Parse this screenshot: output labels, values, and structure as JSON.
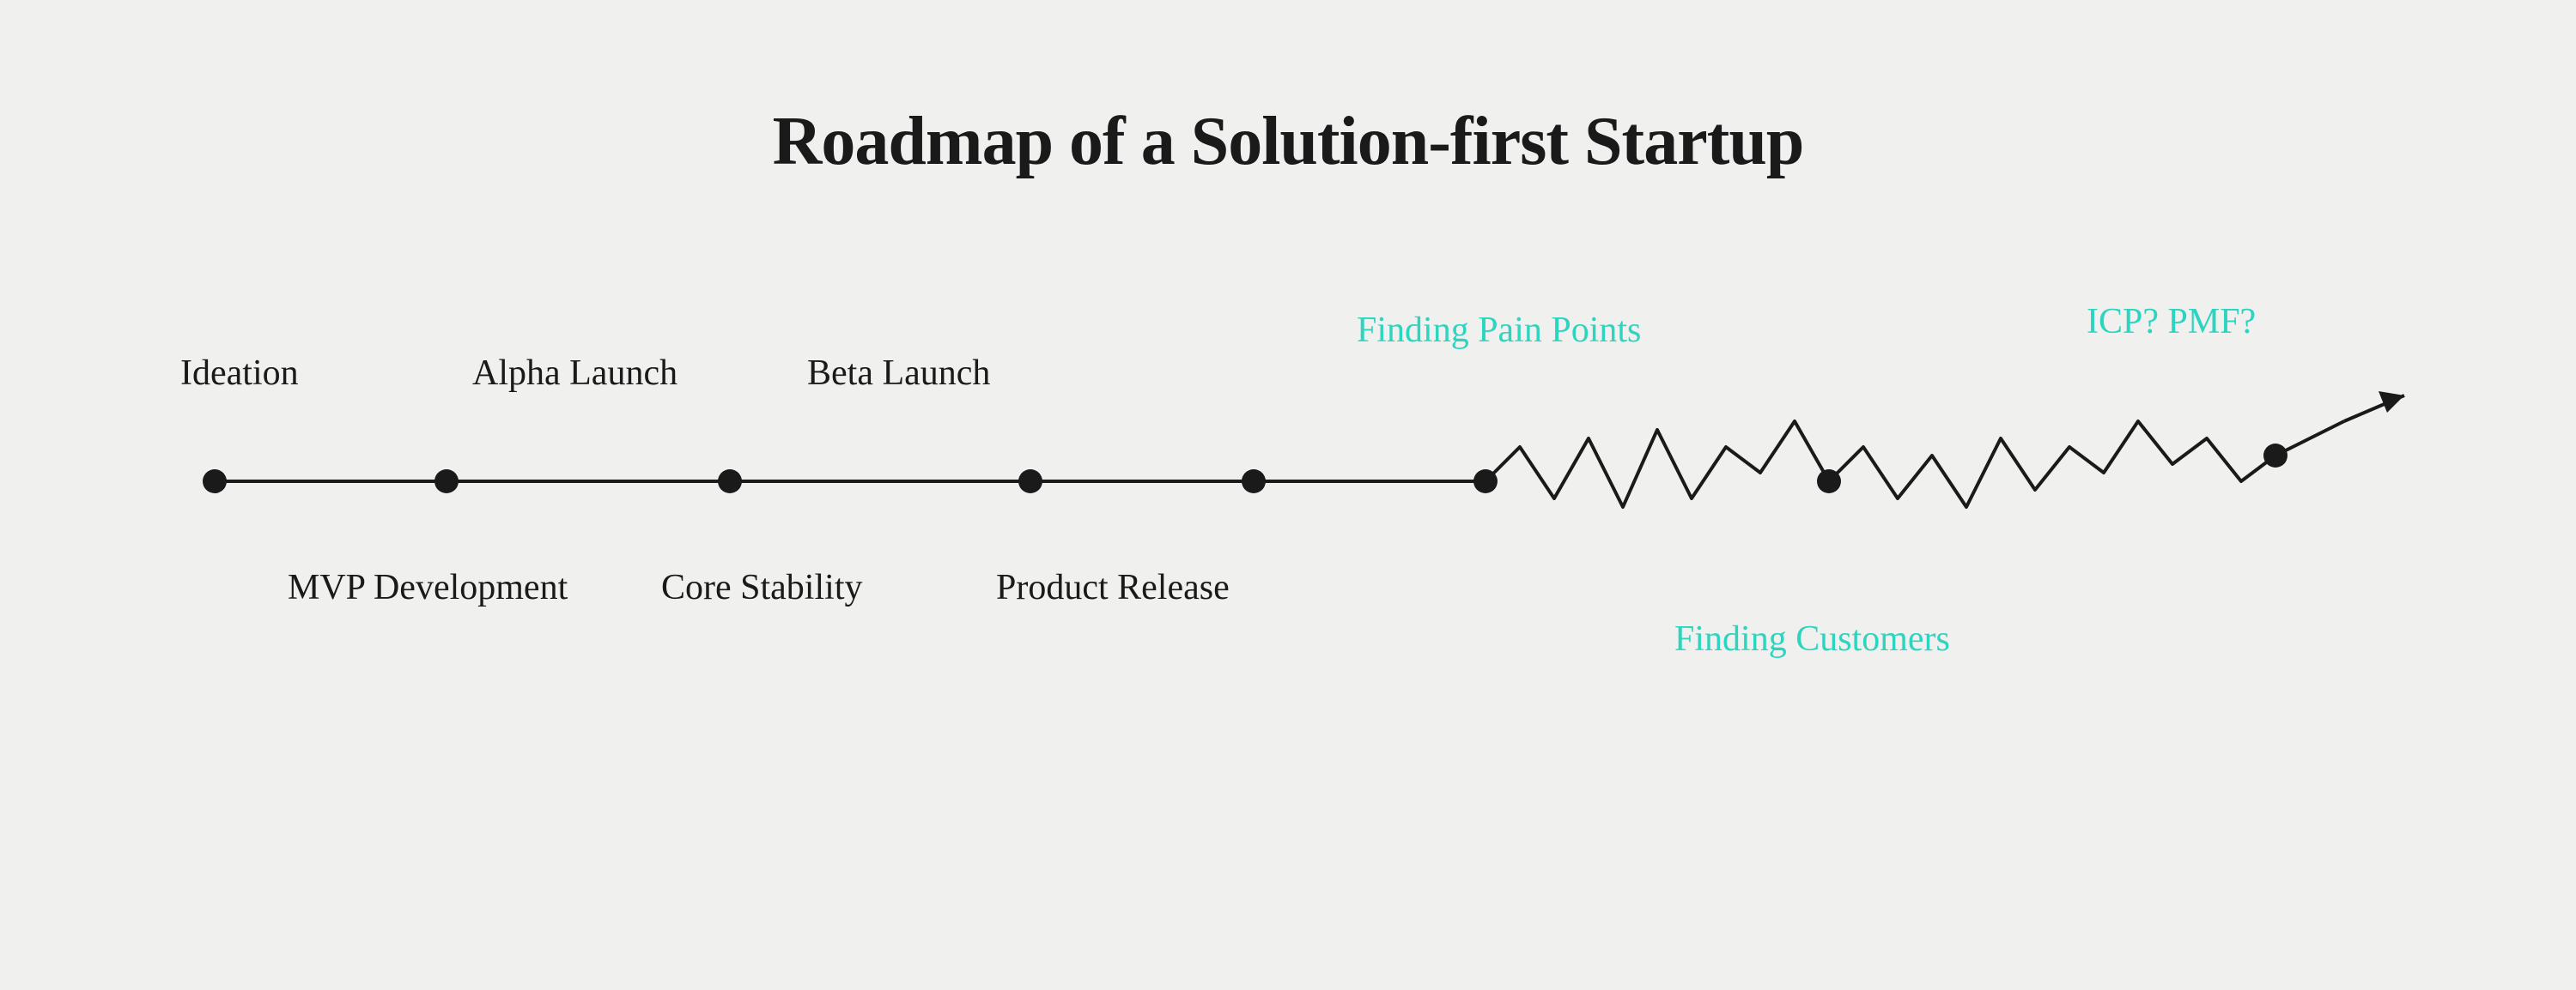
{
  "title": "Roadmap of a Solution-first Startup",
  "labels": {
    "ideation": "Ideation",
    "alpha_launch": "Alpha Launch",
    "beta_launch": "Beta Launch",
    "finding_pain_points": "Finding Pain Points",
    "icp_pmf": "ICP? PMF?",
    "mvp_development": "MVP Development",
    "core_stability": "Core Stability",
    "product_release": "Product Release",
    "finding_customers": "Finding Customers"
  },
  "colors": {
    "background": "#f0f0ee",
    "text_dark": "#1a1a1a",
    "text_teal": "#2dd4bf",
    "line": "#1a1a1a"
  }
}
